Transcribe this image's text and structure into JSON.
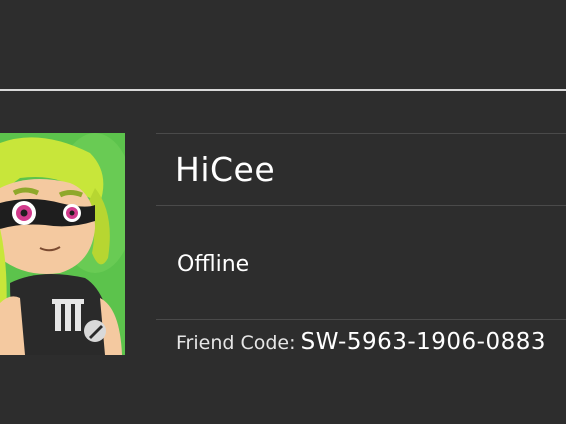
{
  "profile": {
    "name": "HiCee",
    "status": "Offline",
    "friend_code_label": "Friend Code:",
    "friend_code": "SW-5963-1906-0883"
  },
  "icons": {
    "avatar": "inkling-girl-avatar-icon"
  },
  "colors": {
    "background": "#2d2d2d",
    "divider": "#4a4a4a",
    "top_divider": "#d8d8d8",
    "text": "#ffffff",
    "avatar_bg": "#5cc34c"
  }
}
